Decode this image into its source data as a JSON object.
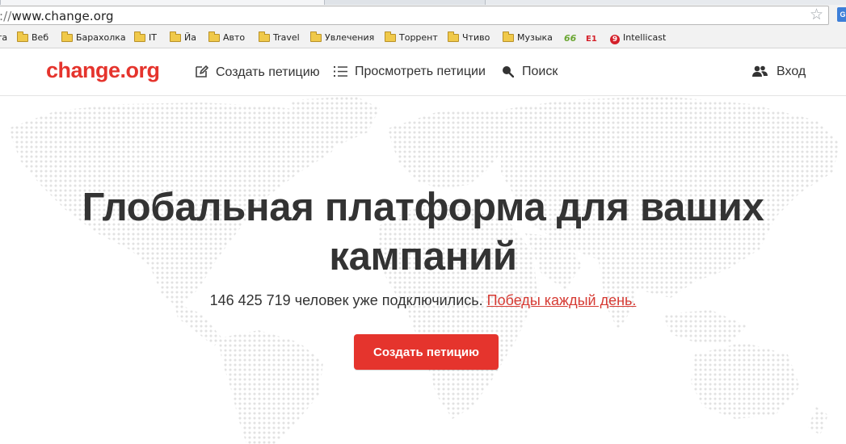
{
  "browser": {
    "url_prefix": "://",
    "url_host": "www.change.org",
    "extension_letter": "G",
    "bookmarks": [
      {
        "label": "та",
        "icon": "none"
      },
      {
        "label": "Веб",
        "icon": "folder-icon"
      },
      {
        "label": "Барахолка",
        "icon": "folder-icon"
      },
      {
        "label": "IT",
        "icon": "folder-icon"
      },
      {
        "label": "Йа",
        "icon": "folder-icon"
      },
      {
        "label": "Авто",
        "icon": "folder-icon"
      },
      {
        "label": "Travel",
        "icon": "folder-icon"
      },
      {
        "label": "Увлечения",
        "icon": "folder-icon"
      },
      {
        "label": "Торрент",
        "icon": "folder-icon"
      },
      {
        "label": "Чтиво",
        "icon": "folder-icon"
      },
      {
        "label": "Музыка",
        "icon": "folder-icon"
      },
      {
        "label": "",
        "icon": "66-icon",
        "glyph": "66"
      },
      {
        "label": "",
        "icon": "e1-icon",
        "glyph": "E1"
      },
      {
        "label": "Intellicast",
        "icon": "intellicast-icon",
        "glyph": "9"
      }
    ]
  },
  "header": {
    "logo": "change.org",
    "nav": {
      "create": "Создать петицию",
      "browse": "Просмотреть петиции",
      "search": "Поиск",
      "login": "Вход"
    }
  },
  "hero": {
    "headline_line1": "Глобальная платформа для ваших",
    "headline_line2": "кампаний",
    "stat_text": "146 425 719 человек уже подключились.",
    "victories_link": "Победы каждый день.",
    "cta_label": "Создать петицию"
  },
  "colors": {
    "brand_red": "#e5342d",
    "link_red": "#d63b34",
    "text": "#333333",
    "map_dots": "#e4e4e4"
  }
}
